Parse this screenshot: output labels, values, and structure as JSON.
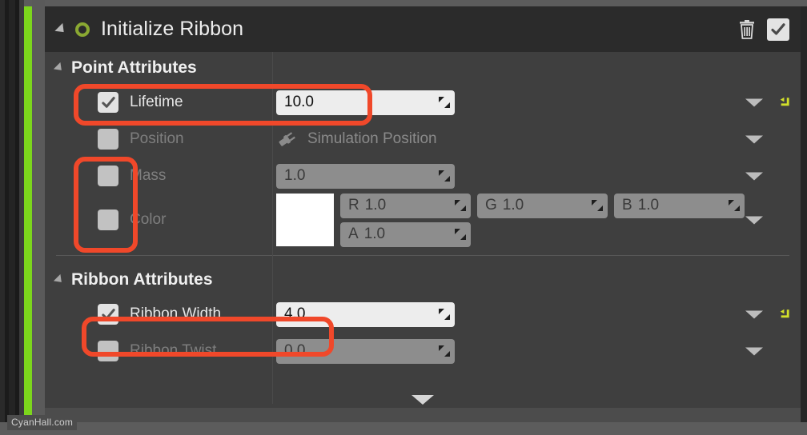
{
  "module": {
    "title": "Initialize Ribbon",
    "collapse_icon": "triangle-collapse-icon",
    "status_icon": "green-ring-icon",
    "delete_icon": "trash-icon",
    "enabled_checkbox": "checkbox-checked-icon"
  },
  "sections": [
    {
      "id": "point-attributes",
      "title": "Point Attributes",
      "rows": [
        {
          "id": "lifetime",
          "label": "Lifetime",
          "checked": true,
          "enabled": true,
          "value": "10.0",
          "has_reset": true
        },
        {
          "id": "position",
          "label": "Position",
          "checked": false,
          "enabled": false,
          "linked_value": "Simulation Position",
          "link_icon": "plug-icon",
          "has_reset": false
        },
        {
          "id": "mass",
          "label": "Mass",
          "checked": false,
          "enabled": false,
          "value": "1.0",
          "has_reset": false
        },
        {
          "id": "color",
          "label": "Color",
          "checked": false,
          "enabled": false,
          "swatch_color": "#ffffff",
          "channels": [
            {
              "prefix": "R",
              "value": "1.0"
            },
            {
              "prefix": "G",
              "value": "1.0"
            },
            {
              "prefix": "B",
              "value": "1.0"
            },
            {
              "prefix": "A",
              "value": "1.0"
            }
          ],
          "has_reset": false
        }
      ]
    },
    {
      "id": "ribbon-attributes",
      "title": "Ribbon Attributes",
      "rows": [
        {
          "id": "ribbon-width",
          "label": "Ribbon Width",
          "checked": true,
          "enabled": true,
          "value": "4.0",
          "has_reset": true
        },
        {
          "id": "ribbon-twist",
          "label": "Ribbon Twist",
          "checked": false,
          "enabled": false,
          "value": "0.0",
          "has_reset": false
        }
      ]
    }
  ],
  "footer": {
    "expander_icon": "expand-more-icon"
  },
  "watermark": "CyanHall.com",
  "colors": {
    "accent_green": "#7cd61c",
    "annotation": "#f0482a",
    "panel_bg": "#3f3f3f",
    "header_bg": "#2b2b2b",
    "reset_icon": "#d2e02a"
  }
}
